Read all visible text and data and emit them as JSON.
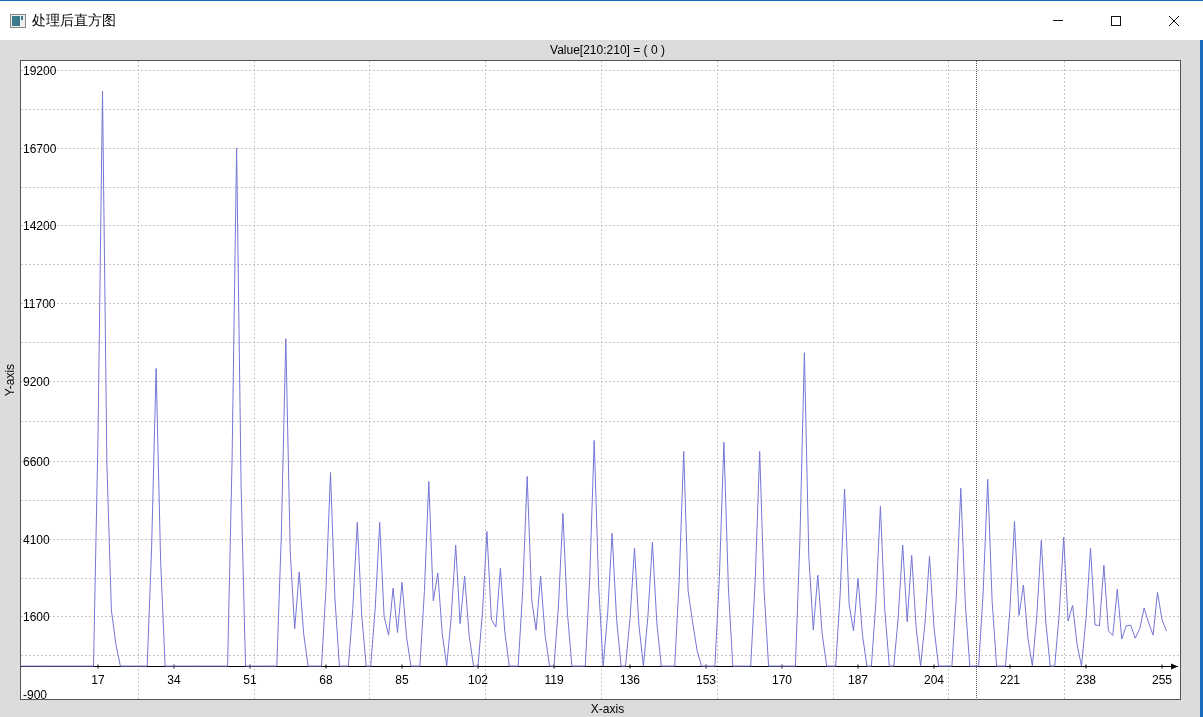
{
  "window": {
    "title": "处理后直方图"
  },
  "plot": {
    "chart_data": {
      "type": "line",
      "title": "Value[210:210] = ( 0 )",
      "xlabel": "X-axis",
      "ylabel": "Y-axis",
      "grid": true,
      "xlim": [
        0,
        258.8
      ],
      "ylim": [
        -1060,
        19500
      ],
      "x": [
        0,
        1,
        2,
        3,
        4,
        5,
        6,
        7,
        8,
        9,
        10,
        11,
        12,
        13,
        14,
        15,
        16,
        17,
        18,
        19,
        20,
        21,
        22,
        23,
        24,
        25,
        26,
        27,
        28,
        29,
        30,
        31,
        32,
        33,
        34,
        35,
        36,
        37,
        38,
        39,
        40,
        41,
        42,
        43,
        44,
        45,
        46,
        47,
        48,
        49,
        50,
        51,
        52,
        53,
        54,
        55,
        56,
        57,
        58,
        59,
        60,
        61,
        62,
        63,
        64,
        65,
        66,
        67,
        68,
        69,
        70,
        71,
        72,
        73,
        74,
        75,
        76,
        77,
        78,
        79,
        80,
        81,
        82,
        83,
        84,
        85,
        86,
        87,
        88,
        89,
        90,
        91,
        92,
        93,
        94,
        95,
        96,
        97,
        98,
        99,
        100,
        101,
        102,
        103,
        104,
        105,
        106,
        107,
        108,
        109,
        110,
        111,
        112,
        113,
        114,
        115,
        116,
        117,
        118,
        119,
        120,
        121,
        122,
        123,
        124,
        125,
        126,
        127,
        128,
        129,
        130,
        131,
        132,
        133,
        134,
        135,
        136,
        137,
        138,
        139,
        140,
        141,
        142,
        143,
        144,
        145,
        146,
        147,
        148,
        149,
        150,
        151,
        152,
        153,
        154,
        155,
        156,
        157,
        158,
        159,
        160,
        161,
        162,
        163,
        164,
        165,
        166,
        167,
        168,
        169,
        170,
        171,
        172,
        173,
        174,
        175,
        176,
        177,
        178,
        179,
        180,
        181,
        182,
        183,
        184,
        185,
        186,
        187,
        188,
        189,
        190,
        191,
        192,
        193,
        194,
        195,
        196,
        197,
        198,
        199,
        200,
        201,
        202,
        203,
        204,
        205,
        206,
        207,
        208,
        209,
        210,
        211,
        212,
        213,
        214,
        215,
        216,
        217,
        218,
        219,
        220,
        221,
        222,
        223,
        224,
        225,
        226,
        227,
        228,
        229,
        230,
        231,
        232,
        233,
        234,
        235,
        236,
        237,
        238,
        239,
        240,
        241,
        242,
        243,
        244,
        245,
        246,
        247,
        248,
        249,
        250,
        251,
        252,
        253,
        254,
        255,
        256
      ],
      "xticks": [
        17,
        34,
        51,
        68,
        85,
        102,
        119,
        136,
        153,
        170,
        187,
        204,
        221,
        238,
        255
      ],
      "yticks": [
        -900,
        1600,
        4100,
        6600,
        9200,
        11700,
        14200,
        16700,
        19200
      ],
      "ref_lines": [
        {
          "axis": "x",
          "value": 213.4
        }
      ],
      "series": [
        {
          "color": "#7575d6",
          "values": [
            0,
            0,
            0,
            0,
            0,
            0,
            0,
            0,
            0,
            0,
            0,
            0,
            0,
            0,
            0,
            0,
            0,
            7400,
            18530,
            6500,
            1800,
            700,
            0,
            0,
            0,
            0,
            0,
            0,
            0,
            3800,
            9590,
            3400,
            0,
            0,
            0,
            0,
            0,
            0,
            0,
            0,
            0,
            0,
            0,
            0,
            0,
            0,
            0,
            6700,
            16700,
            5800,
            0,
            0,
            0,
            0,
            0,
            0,
            0,
            0,
            4200,
            10550,
            3700,
            1200,
            3030,
            1060,
            0,
            0,
            0,
            0,
            2500,
            6240,
            2200,
            0,
            0,
            0,
            1850,
            4630,
            1600,
            0,
            0,
            1850,
            4630,
            1600,
            1000,
            2510,
            1080,
            2700,
            950,
            0,
            0,
            0,
            2400,
            5950,
            2100,
            3000,
            1050,
            0,
            1560,
            3900,
            1370,
            2900,
            1000,
            0,
            0,
            1740,
            4340,
            1500,
            1260,
            3150,
            1100,
            0,
            0,
            0,
            2440,
            6110,
            2140,
            1160,
            2900,
            1000,
            0,
            0,
            1970,
            4920,
            1720,
            0,
            0,
            0,
            0,
            2900,
            7270,
            2540,
            0,
            1710,
            4280,
            1500,
            0,
            0,
            1520,
            3800,
            1330,
            0,
            1600,
            3990,
            1400,
            0,
            0,
            0,
            0,
            2770,
            6920,
            2420,
            1420,
            500,
            0,
            0,
            0,
            0,
            2880,
            7210,
            2520,
            0,
            0,
            0,
            0,
            0,
            2770,
            6920,
            2420,
            0,
            0,
            0,
            0,
            0,
            0,
            0,
            4040,
            10100,
            3540,
            1170,
            2930,
            1030,
            0,
            0,
            0,
            2280,
            5700,
            2000,
            1130,
            2830,
            990,
            0,
            0,
            2060,
            5150,
            1800,
            0,
            0,
            1560,
            3900,
            1430,
            3570,
            1250,
            0,
            1420,
            3540,
            1240,
            0,
            0,
            0,
            0,
            2290,
            5730,
            2010,
            0,
            0,
            0,
            2410,
            6020,
            2110,
            0,
            0,
            0,
            1870,
            4670,
            1630,
            2610,
            910,
            0,
            1620,
            4050,
            1420,
            0,
            0,
            1660,
            4150,
            1450,
            1960,
            690,
            0,
            1520,
            3800,
            1330,
            1300,
            3250,
            1140,
            990,
            2480,
            870,
            1300,
            1320,
            900,
            1200,
            1870,
            1400,
            1000,
            2380,
            1500,
            1130
          ]
        }
      ]
    }
  }
}
